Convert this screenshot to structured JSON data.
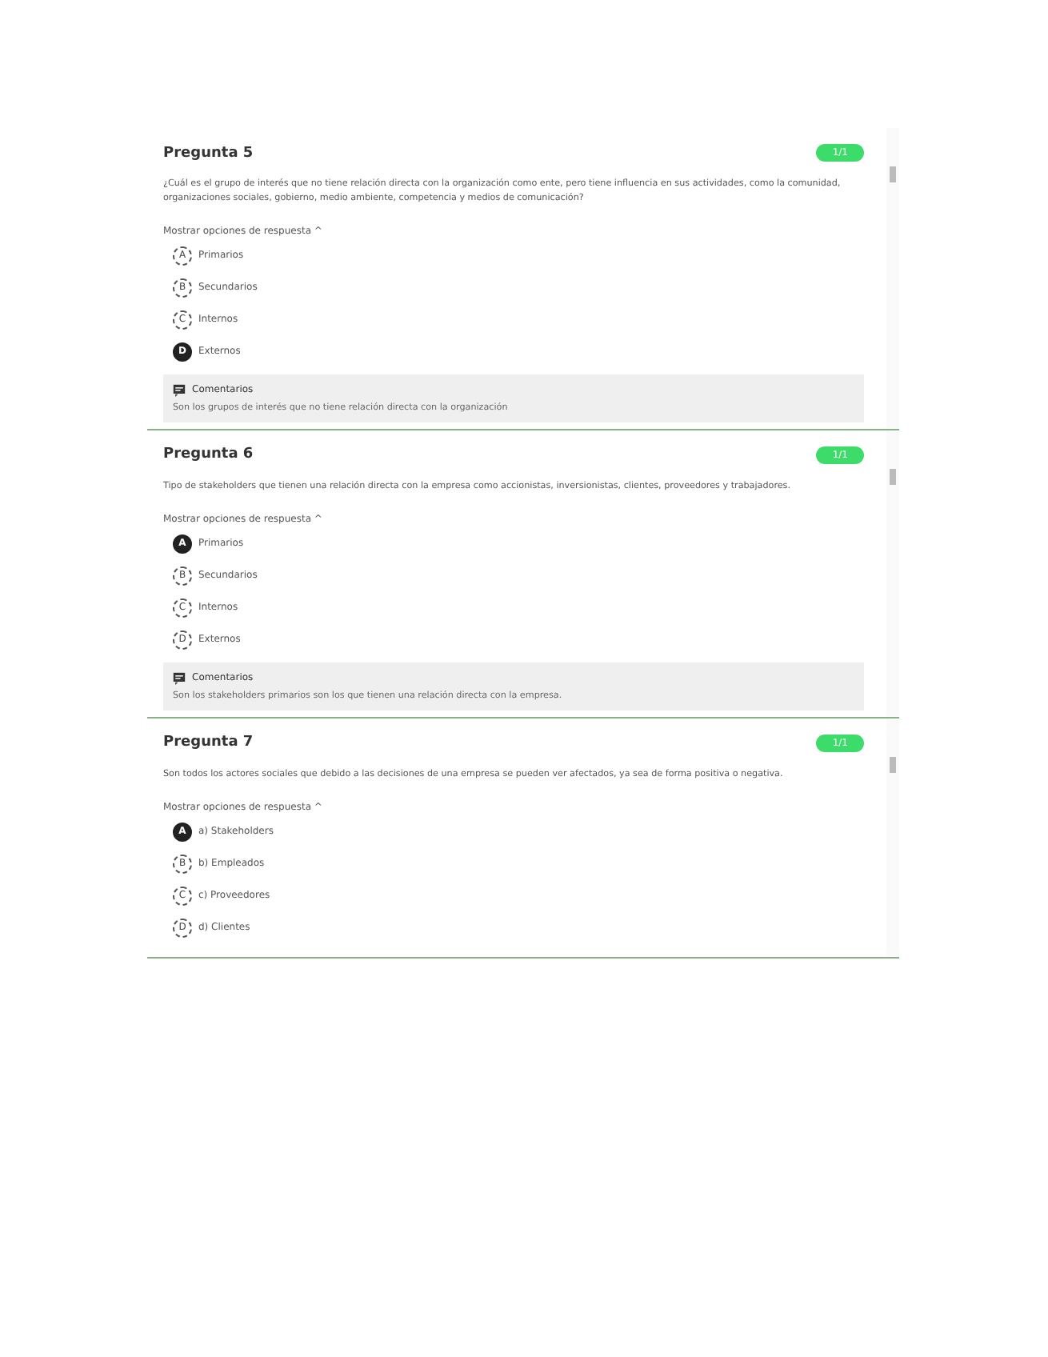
{
  "questions": [
    {
      "title": "Pregunta 5",
      "score": "1/1",
      "text": "¿Cuál es el grupo de interés que no tiene relación directa con la organización como ente, pero tiene influencia en sus actividades, como la comunidad, organizaciones sociales, gobierno, medio ambiente, competencia y medios de comunicación?",
      "toggle": "Mostrar opciones de respuesta ^",
      "options": [
        {
          "letter": "A",
          "text": "Primarios",
          "selected": false
        },
        {
          "letter": "B",
          "text": "Secundarios",
          "selected": false
        },
        {
          "letter": "C",
          "text": "Internos",
          "selected": false
        },
        {
          "letter": "D",
          "text": "Externos",
          "selected": true
        }
      ],
      "comment": {
        "title": "Comentarios",
        "text": "Son los grupos de interés que no tiene relación directa con la organización"
      }
    },
    {
      "title": "Pregunta 6",
      "score": "1/1",
      "text": "Tipo de stakeholders que tienen una relación directa con la empresa como accionistas, inversionistas, clientes, proveedores y trabajadores.",
      "toggle": "Mostrar opciones de respuesta ^",
      "options": [
        {
          "letter": "A",
          "text": "Primarios",
          "selected": true
        },
        {
          "letter": "B",
          "text": "Secundarios",
          "selected": false
        },
        {
          "letter": "C",
          "text": "Internos",
          "selected": false
        },
        {
          "letter": "D",
          "text": "Externos",
          "selected": false
        }
      ],
      "comment": {
        "title": "Comentarios",
        "text": "Son los stakeholders primarios son los que tienen una relación directa con la empresa."
      }
    },
    {
      "title": "Pregunta 7",
      "score": "1/1",
      "text": "Son todos los actores sociales que debido a las decisiones de una empresa se pueden ver afectados, ya sea de forma positiva o negativa.",
      "toggle": "Mostrar opciones de respuesta ^",
      "options": [
        {
          "letter": "A",
          "text": "a) Stakeholders",
          "selected": true
        },
        {
          "letter": "B",
          "text": "b) Empleados",
          "selected": false
        },
        {
          "letter": "C",
          "text": "c) Proveedores",
          "selected": false
        },
        {
          "letter": "D",
          "text": "d) Clientes",
          "selected": false
        }
      ]
    }
  ]
}
